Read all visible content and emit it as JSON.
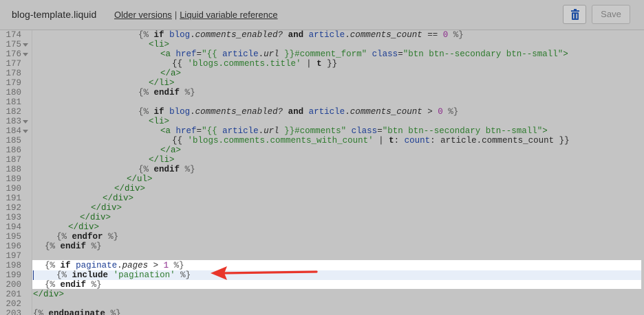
{
  "header": {
    "filename": "blog-template.liquid",
    "older_versions": "Older versions",
    "separator": "|",
    "liquid_reference": "Liquid variable reference",
    "save_label": "Save",
    "delete_icon": "trash-icon"
  },
  "editor": {
    "line_numbers": [
      "174",
      "175",
      "176",
      "177",
      "178",
      "179",
      "180",
      "181",
      "182",
      "183",
      "184",
      "185",
      "186",
      "187",
      "188",
      "189",
      "190",
      "191",
      "192",
      "193",
      "194",
      "195",
      "196",
      "197",
      "198",
      "199",
      "200",
      "201",
      "202",
      "203"
    ],
    "highlighted_lines": [
      "198",
      "199",
      "200"
    ],
    "active_line": "199",
    "annotation": "red-arrow-pointing-to-line-199"
  },
  "lines": {
    "l174": [
      "{%",
      " ",
      "if",
      " ",
      "blog",
      ".",
      "comments_enabled?",
      " ",
      "and",
      " ",
      "article",
      ".",
      "comments_count",
      " == ",
      "0",
      " ",
      "%}"
    ],
    "l175": [
      "<li>"
    ],
    "l176": [
      "<a",
      " ",
      "href",
      "=",
      "\"{{ ",
      "article",
      ".",
      "url",
      " }}#comment_form\"",
      " ",
      "class",
      "=",
      "\"btn btn--secondary btn--small\"",
      ">"
    ],
    "l177": [
      "{{",
      " ",
      "'blogs.comments.title'",
      " | ",
      "t",
      " ",
      "}}"
    ],
    "l178": [
      "</a>"
    ],
    "l179": [
      "</li>"
    ],
    "l180": [
      "{%",
      " ",
      "endif",
      " ",
      "%}"
    ],
    "l182": [
      "{%",
      " ",
      "if",
      " ",
      "blog",
      ".",
      "comments_enabled?",
      " ",
      "and",
      " ",
      "article",
      ".",
      "comments_count",
      " > ",
      "0",
      " ",
      "%}"
    ],
    "l183": [
      "<li>"
    ],
    "l184": [
      "<a",
      " ",
      "href",
      "=",
      "\"{{ ",
      "article",
      ".",
      "url",
      " }}#comments\"",
      " ",
      "class",
      "=",
      "\"btn btn--secondary btn--small\"",
      ">"
    ],
    "l185": [
      "{{",
      " ",
      "'blogs.comments.comments_with_count'",
      " | ",
      "t",
      ": ",
      "count",
      ": article.comments_count ",
      "}}"
    ],
    "l186": [
      "</a>"
    ],
    "l187": [
      "</li>"
    ],
    "l188": [
      "{%",
      " ",
      "endif",
      " ",
      "%}"
    ],
    "l189": [
      "</ul>"
    ],
    "l190": [
      "</div>"
    ],
    "l191": [
      "</div>"
    ],
    "l192": [
      "</div>"
    ],
    "l193": [
      "</div>"
    ],
    "l194": [
      "</div>"
    ],
    "l195": [
      "{%",
      " ",
      "endfor",
      " ",
      "%}"
    ],
    "l196": [
      "{%",
      " ",
      "endif",
      " ",
      "%}"
    ],
    "l198": [
      "{%",
      " ",
      "if",
      " ",
      "paginate",
      ".",
      "pages",
      " > ",
      "1",
      " ",
      "%}"
    ],
    "l199": [
      "{%",
      " ",
      "include",
      " ",
      "'pagination'",
      " ",
      "%}"
    ],
    "l200": [
      "{%",
      " ",
      "endif",
      " ",
      "%}"
    ],
    "l201": [
      "</div>"
    ],
    "l203": [
      "{%",
      " ",
      "endpaginate",
      " ",
      "%}"
    ]
  }
}
